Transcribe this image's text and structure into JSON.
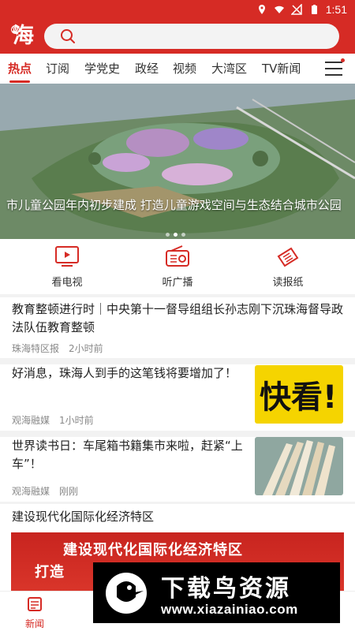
{
  "status_bar": {
    "time": "1:51"
  },
  "header": {
    "logo_text": "海",
    "logo_small": "观"
  },
  "tabs": [
    {
      "label": "热点",
      "active": true
    },
    {
      "label": "订阅"
    },
    {
      "label": "学党史"
    },
    {
      "label": "政经"
    },
    {
      "label": "视频"
    },
    {
      "label": "大湾区"
    },
    {
      "label": "TV新闻"
    }
  ],
  "banner": {
    "caption": "市儿童公园年内初步建成 打造儿童游戏空间与生态结合城市公园",
    "slide_count": 3,
    "active_slide": 2
  },
  "quick_links": [
    {
      "label": "看电视",
      "icon": "tv-icon"
    },
    {
      "label": "听广播",
      "icon": "radio-icon"
    },
    {
      "label": "读报纸",
      "icon": "newspaper-icon"
    }
  ],
  "news": [
    {
      "title": "教育整顿进行时｜中央第十一督导组组长孙志刚下沉珠海督导政法队伍教育整顿",
      "source": "珠海特区报",
      "time": "2小时前"
    },
    {
      "title": "好消息，珠海人到手的这笔钱将要增加了！",
      "source": "观海融媒",
      "time": "1小时前",
      "thumb_text": "快看!"
    },
    {
      "title": "世界读书日：车尾箱书籍集市来啦，赶紧“上车”！",
      "source": "观海融媒",
      "time": "刚刚"
    }
  ],
  "section": {
    "title": "建设现代化国际化经济特区",
    "banner_line1": "建设现代化国际化经济特区",
    "banner_line2": "打造"
  },
  "bottom_nav": [
    {
      "label": "新闻",
      "active": true
    }
  ],
  "watermark": {
    "title": "下载鸟资源",
    "url": "www.xiazainiao.com"
  },
  "colors": {
    "brand": "#d62b25"
  }
}
